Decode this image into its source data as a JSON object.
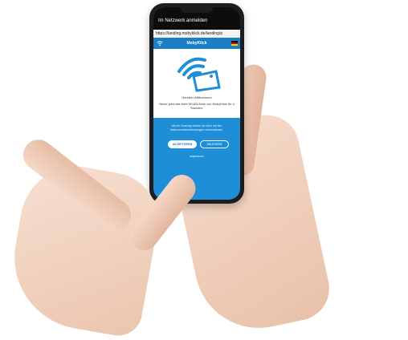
{
  "status_bar": {
    "title": "Im Netzwerk anmelden"
  },
  "url_bar": {
    "url": "https://landing.mobyklick.de/landing/p"
  },
  "app": {
    "name": "MobyKlick",
    "language_flag": "germany-flag-icon"
  },
  "card": {
    "welcome": "Herzlich Willkommen",
    "body": "Nutze jetzt das freie WLAN-Netz von MobyKlick für 4 Stunden."
  },
  "terms": {
    "text": "Mit der Nutzung erkläre ich mich mit den Datenschutzbestimmungen einverstanden."
  },
  "buttons": {
    "accept": "AKZEPTIEREN",
    "decline": "ABLEHNEN"
  },
  "footer": {
    "imprint": "Impressum"
  },
  "colors": {
    "brand_blue": "#1e8ed6",
    "header_blue": "#1a7fc7"
  }
}
